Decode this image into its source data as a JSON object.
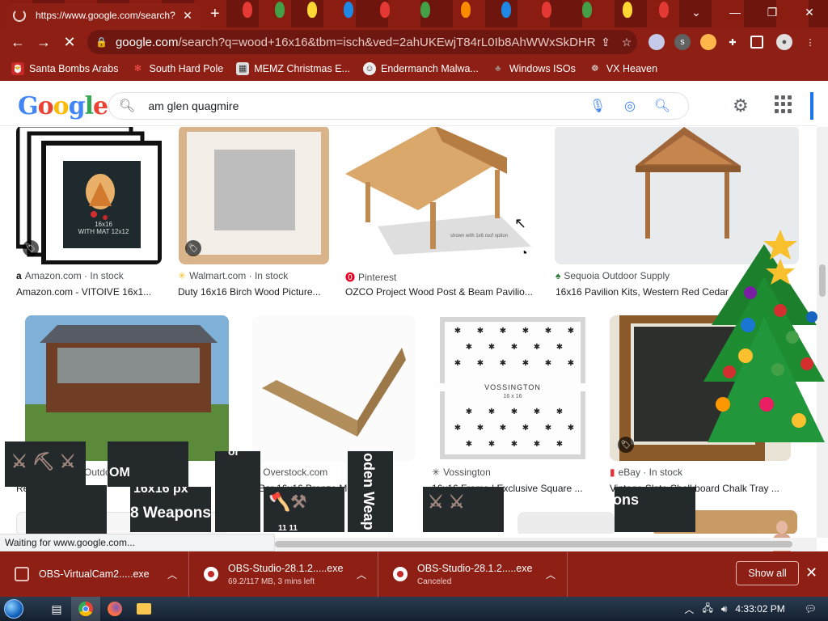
{
  "browser": {
    "tab_title": "https://www.google.com/search?",
    "address_host": "google.com",
    "address_rest": "/search?q=wood+16x16&tbm=isch&ved=2ahUKEwjT84rL0Ib8AhWWxSkDHRijC...",
    "bookmarks": [
      {
        "label": "Santa Bombs Arabs",
        "icon": "santa-icon",
        "color": "#c62828"
      },
      {
        "label": "South Hard Pole",
        "icon": "snowflake-icon",
        "color": "#b71c1c"
      },
      {
        "label": "MEMZ Christmas E...",
        "icon": "window-icon",
        "color": "#dddddd"
      },
      {
        "label": "Endermanch Malwa...",
        "icon": "face-icon",
        "color": "#eeeeee"
      },
      {
        "label": "Windows ISOs",
        "icon": "tree-icon",
        "color": "#8d6e63"
      },
      {
        "label": "VX Heaven",
        "icon": "heaven-icon",
        "color": "#9e9e9e"
      }
    ]
  },
  "google": {
    "logo": [
      "G",
      "o",
      "o",
      "g",
      "l",
      "e"
    ],
    "query": "am glen quagmire"
  },
  "results": [
    {
      "source": "Amazon.com · In stock",
      "title": "Amazon.com - VITOIVE 16x1...",
      "src_icon": "amazon-icon"
    },
    {
      "source": "Walmart.com · In stock",
      "title": "Duty 16x16 Birch Wood Picture...",
      "src_icon": "walmart-icon"
    },
    {
      "source": "Pinterest",
      "title": "OZCO Project Wood Post & Beam Pavilio...",
      "src_icon": "pinterest-icon"
    },
    {
      "source": "Sequoia Outdoor Supply",
      "title": "16x16 Pavilion Kits, Western Red Cedar ...",
      "src_icon": "sequoia-icon"
    },
    {
      "source": "Outdo",
      "title": "Re",
      "src_icon": "none"
    },
    {
      "source": "Overstock.com",
      "title": "Bar 16x16 Bronze Metallic",
      "src_icon": "overstock-icon"
    },
    {
      "source": "Vossington",
      "title": "16x16 Frame | Exclusive Square ...",
      "src_icon": "vossington-icon"
    },
    {
      "source": "eBay · In stock",
      "title": "Vintage Slate Chalkboard Chalk Tray ...",
      "src_icon": "ebay-icon"
    }
  ],
  "image_texts": {
    "frame_caption": "16x16\nWITH MAT 12x12",
    "vossington_brand": "VOSSINGTON",
    "vossington_size": "16 x 16",
    "pavilion_caption": "shown with 1x6 roof option"
  },
  "overlays": {
    "p1": "OM",
    "p2": "16x16 px",
    "p3": "8 Weapons",
    "p4": "oden Weap",
    "p5": "ons",
    "p6": "or",
    "p7": "11 11"
  },
  "status_text": "Waiting for www.google.com...",
  "downloads": [
    {
      "name": "OBS-VirtualCam2.....exe",
      "sub": ""
    },
    {
      "name": "OBS-Studio-28.1.2.....exe",
      "sub": "69.2/117 MB, 3 mins left"
    },
    {
      "name": "OBS-Studio-28.1.2.....exe",
      "sub": "Canceled"
    }
  ],
  "downloads_show_all": "Show all",
  "taskbar": {
    "time": "4:33:02 PM"
  }
}
